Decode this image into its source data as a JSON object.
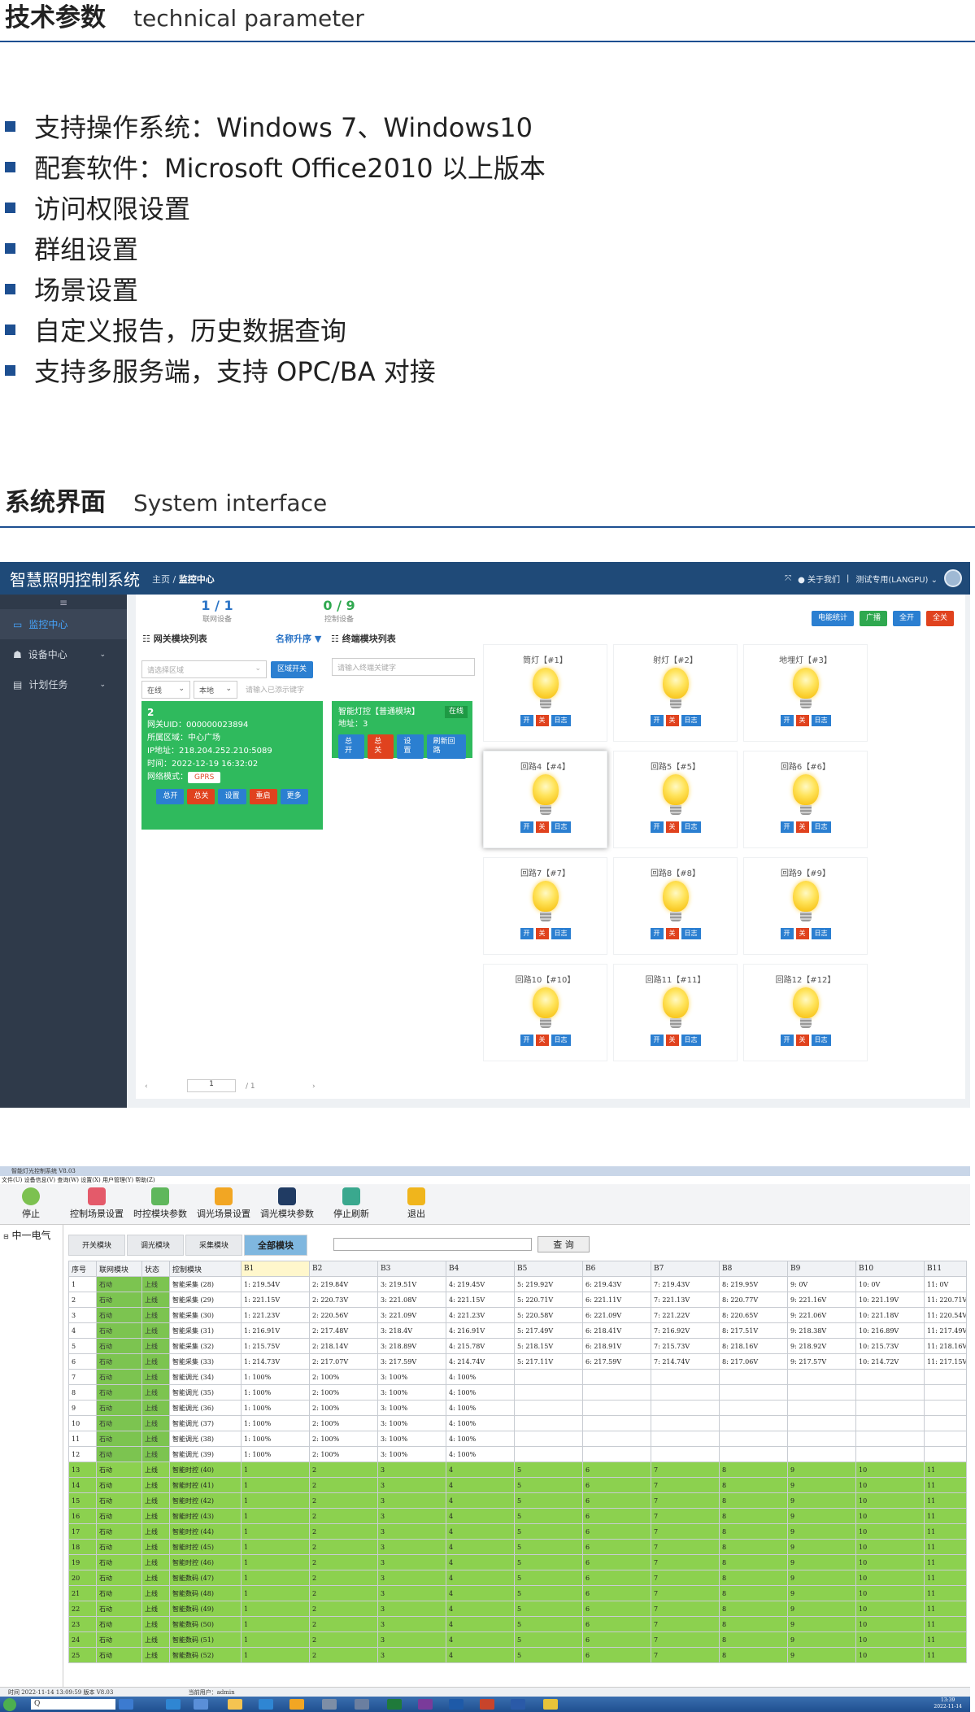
{
  "section1": {
    "title_zh": "技术参数",
    "title_en": "technical parameter"
  },
  "bullets": [
    "支持操作系统：Windows 7、Windows10",
    "配套软件：Microsoft Office2010 以上版本",
    "访问权限设置",
    "群组设置",
    "场景设置",
    "自定义报告，历史数据查询",
    "支持多服务端，支持 OPC/BA 对接"
  ],
  "section2": {
    "title_zh": "系统界面",
    "title_en": "System interface"
  },
  "web": {
    "brand": "智慧照明控制系统",
    "crumb_home": "主页",
    "crumb_current": "监控中心",
    "top_about": "关于我们",
    "top_user": "测试专用(LANGPU)",
    "menu_icon": "≡",
    "sidebar": [
      "监控中心",
      "设备中心",
      "计划任务"
    ],
    "stats": [
      {
        "n": "1 / 1",
        "l": "联网设备"
      },
      {
        "n": "0 / 9",
        "l": "控制设备"
      }
    ],
    "top_buttons": [
      "电能统计",
      "广播",
      "全开",
      "全关"
    ],
    "gw_list_title": "网关模块列表",
    "sort_label": "名称升序",
    "term_list_title": "终端模块列表",
    "area_placeholder": "请选择区域",
    "area_btn": "区域开关",
    "status_sel": "在线",
    "local_sel": "本地",
    "gw_search_placeholder": "请输入已添示键字",
    "term_search_placeholder": "请输入终端关键字",
    "gw_card": {
      "num": "2",
      "uid": "网关UID：000000023894",
      "area": "所属区域：中心广场",
      "ip": "IP地址：218.204.252.210:5089",
      "time": "时间：2022-12-19 16:32:02",
      "mode_label": "网络模式：",
      "mode": "GPRS",
      "buttons": [
        "总开",
        "总关",
        "设置",
        "重启",
        "更多"
      ]
    },
    "term_card": {
      "name": "智能灯控【普通模块】",
      "online": "在线",
      "addr": "地址：3",
      "buttons": [
        "总开",
        "总关",
        "设置",
        "刷新回路"
      ]
    },
    "lamps": [
      "筒灯【#1】",
      "射灯【#2】",
      "地埋灯【#3】",
      "回路4【#4】",
      "回路5【#5】",
      "回路6【#6】",
      "回路7【#7】",
      "回路8【#8】",
      "回路9【#9】",
      "回路10【#10】",
      "回路11【#11】",
      "回路12【#12】"
    ],
    "lamp_buttons": [
      "开",
      "关",
      "日志"
    ],
    "pager": {
      "page": "1",
      "total": "/ 1",
      "prev": "‹",
      "next": "›"
    }
  },
  "app": {
    "window_title": "智能灯光控制系统 V8.03",
    "menus": [
      "文件(U)",
      "设备信息(V)",
      "查询(W)",
      "设置(X)",
      "用户管理(Y)",
      "帮助(Z)"
    ],
    "toolbar": [
      "停止",
      "控制场景设置",
      "时控模块参数",
      "调光场景设置",
      "调光模块参数",
      "停止刷新",
      "退出"
    ],
    "tree_root": "中一电气",
    "tree_toggle": "⊟",
    "tabs": [
      "开关模块",
      "调光模块",
      "采集模块",
      "全部模块"
    ],
    "query_btn": "查 询",
    "headers": [
      "序号",
      "联网模块",
      "状态",
      "控制模块",
      "B1",
      "B2",
      "B3",
      "B4",
      "B5",
      "B6",
      "B7",
      "B8",
      "B9",
      "B10",
      "B11"
    ],
    "rows": [
      [
        "1",
        "石动",
        "上线",
        "智能采集 (28)",
        "1: 219.54V",
        "2: 219.84V",
        "3: 219.51V",
        "4: 219.45V",
        "5: 219.92V",
        "6: 219.43V",
        "7: 219.43V",
        "8: 219.95V",
        "9: 0V",
        "10: 0V",
        "11: 0V"
      ],
      [
        "2",
        "石动",
        "上线",
        "智能采集 (29)",
        "1: 221.15V",
        "2: 220.73V",
        "3: 221.08V",
        "4: 221.15V",
        "5: 220.71V",
        "6: 221.11V",
        "7: 221.13V",
        "8: 220.77V",
        "9: 221.16V",
        "10: 221.19V",
        "11: 220.71V"
      ],
      [
        "3",
        "石动",
        "上线",
        "智能采集 (30)",
        "1: 221.23V",
        "2: 220.56V",
        "3: 221.09V",
        "4: 221.23V",
        "5: 220.58V",
        "6: 221.09V",
        "7: 221.22V",
        "8: 220.65V",
        "9: 221.06V",
        "10: 221.18V",
        "11: 220.54V"
      ],
      [
        "4",
        "石动",
        "上线",
        "智能采集 (31)",
        "1: 216.91V",
        "2: 217.48V",
        "3: 218.4V",
        "4: 216.91V",
        "5: 217.49V",
        "6: 218.41V",
        "7: 216.92V",
        "8: 217.51V",
        "9: 218.38V",
        "10: 216.89V",
        "11: 217.49V"
      ],
      [
        "5",
        "石动",
        "上线",
        "智能采集 (32)",
        "1: 215.75V",
        "2: 218.14V",
        "3: 218.89V",
        "4: 215.78V",
        "5: 218.15V",
        "6: 218.91V",
        "7: 215.73V",
        "8: 218.16V",
        "9: 218.92V",
        "10: 215.73V",
        "11: 218.16V"
      ],
      [
        "6",
        "石动",
        "上线",
        "智能采集 (33)",
        "1: 214.73V",
        "2: 217.07V",
        "3: 217.59V",
        "4: 214.74V",
        "5: 217.11V",
        "6: 217.59V",
        "7: 214.74V",
        "8: 217.06V",
        "9: 217.57V",
        "10: 214.72V",
        "11: 217.15V"
      ],
      [
        "7",
        "石动",
        "上线",
        "智能调光 (34)",
        "1: 100%",
        "2: 100%",
        "3: 100%",
        "4: 100%",
        "",
        "",
        "",
        "",
        "",
        "",
        ""
      ],
      [
        "8",
        "石动",
        "上线",
        "智能调光 (35)",
        "1: 100%",
        "2: 100%",
        "3: 100%",
        "4: 100%",
        "",
        "",
        "",
        "",
        "",
        "",
        ""
      ],
      [
        "9",
        "石动",
        "上线",
        "智能调光 (36)",
        "1: 100%",
        "2: 100%",
        "3: 100%",
        "4: 100%",
        "",
        "",
        "",
        "",
        "",
        "",
        ""
      ],
      [
        "10",
        "石动",
        "上线",
        "智能调光 (37)",
        "1: 100%",
        "2: 100%",
        "3: 100%",
        "4: 100%",
        "",
        "",
        "",
        "",
        "",
        "",
        ""
      ],
      [
        "11",
        "石动",
        "上线",
        "智能调光 (38)",
        "1: 100%",
        "2: 100%",
        "3: 100%",
        "4: 100%",
        "",
        "",
        "",
        "",
        "",
        "",
        ""
      ],
      [
        "12",
        "石动",
        "上线",
        "智能调光 (39)",
        "1: 100%",
        "2: 100%",
        "3: 100%",
        "4: 100%",
        "",
        "",
        "",
        "",
        "",
        "",
        ""
      ],
      [
        "13",
        "石动",
        "上线",
        "智能时控 (40)",
        "1",
        "2",
        "3",
        "4",
        "5",
        "6",
        "7",
        "8",
        "9",
        "10",
        "11"
      ],
      [
        "14",
        "石动",
        "上线",
        "智能时控 (41)",
        "1",
        "2",
        "3",
        "4",
        "5",
        "6",
        "7",
        "8",
        "9",
        "10",
        "11"
      ],
      [
        "15",
        "石动",
        "上线",
        "智能时控 (42)",
        "1",
        "2",
        "3",
        "4",
        "5",
        "6",
        "7",
        "8",
        "9",
        "10",
        "11"
      ],
      [
        "16",
        "石动",
        "上线",
        "智能时控 (43)",
        "1",
        "2",
        "3",
        "4",
        "5",
        "6",
        "7",
        "8",
        "9",
        "10",
        "11"
      ],
      [
        "17",
        "石动",
        "上线",
        "智能时控 (44)",
        "1",
        "2",
        "3",
        "4",
        "5",
        "6",
        "7",
        "8",
        "9",
        "10",
        "11"
      ],
      [
        "18",
        "石动",
        "上线",
        "智能时控 (45)",
        "1",
        "2",
        "3",
        "4",
        "5",
        "6",
        "7",
        "8",
        "9",
        "10",
        "11"
      ],
      [
        "19",
        "石动",
        "上线",
        "智能时控 (46)",
        "1",
        "2",
        "3",
        "4",
        "5",
        "6",
        "7",
        "8",
        "9",
        "10",
        "11"
      ],
      [
        "20",
        "石动",
        "上线",
        "智能数码 (47)",
        "1",
        "2",
        "3",
        "4",
        "5",
        "6",
        "7",
        "8",
        "9",
        "10",
        "11"
      ],
      [
        "21",
        "石动",
        "上线",
        "智能数码 (48)",
        "1",
        "2",
        "3",
        "4",
        "5",
        "6",
        "7",
        "8",
        "9",
        "10",
        "11"
      ],
      [
        "22",
        "石动",
        "上线",
        "智能数码 (49)",
        "1",
        "2",
        "3",
        "4",
        "5",
        "6",
        "7",
        "8",
        "9",
        "10",
        "11"
      ],
      [
        "23",
        "石动",
        "上线",
        "智能数码 (50)",
        "1",
        "2",
        "3",
        "4",
        "5",
        "6",
        "7",
        "8",
        "9",
        "10",
        "11"
      ],
      [
        "24",
        "石动",
        "上线",
        "智能数码 (51)",
        "1",
        "2",
        "3",
        "4",
        "5",
        "6",
        "7",
        "8",
        "9",
        "10",
        "11"
      ],
      [
        "25",
        "石动",
        "上线",
        "智能数码 (52)",
        "1",
        "2",
        "3",
        "4",
        "5",
        "6",
        "7",
        "8",
        "9",
        "10",
        "11"
      ]
    ],
    "status_left": "时间    2022-11-14 13:09:59    版本    V8.03",
    "status_user": "当前用户：admin",
    "taskbar_search": "Q",
    "clock_time": "13:39",
    "clock_date": "2022-11-14"
  },
  "colors": {
    "accent": "#1d4f91",
    "web_header": "#1f4a78",
    "card_green": "#2fba5d",
    "row_green": "#8cd14f"
  }
}
